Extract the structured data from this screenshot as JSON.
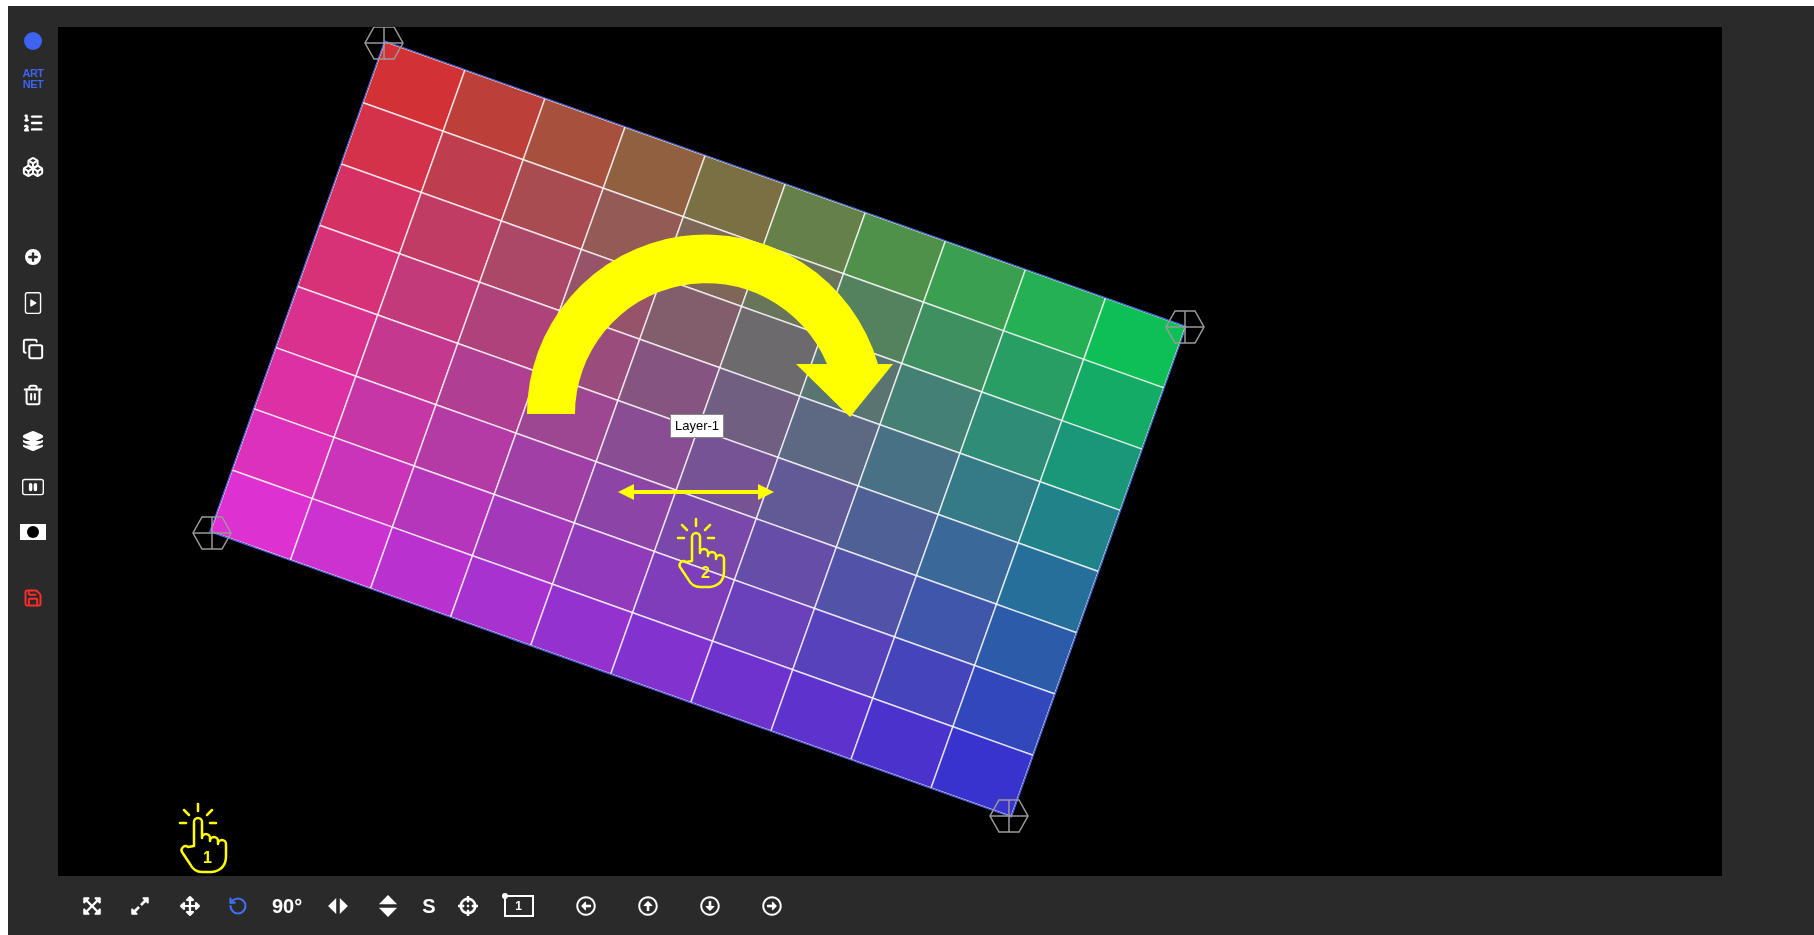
{
  "sidebar": {
    "logo": [
      "ART",
      "NET"
    ]
  },
  "canvas": {
    "layer": {
      "label": "Layer-1"
    },
    "annotations": [
      {
        "kind": "hand",
        "label": "2"
      },
      {
        "kind": "hand",
        "label": "1"
      }
    ]
  },
  "toolbar": [
    {
      "kind": "icon",
      "selected": false
    },
    {
      "kind": "icon",
      "selected": false
    },
    {
      "kind": "icon",
      "selected": false
    },
    {
      "kind": "icon",
      "selected": true
    },
    {
      "kind": "text",
      "label": "90°",
      "selected": false
    },
    {
      "kind": "icon",
      "selected": false
    },
    {
      "kind": "icon",
      "selected": false
    },
    {
      "kind": "text",
      "label": "S",
      "selected": false
    },
    {
      "kind": "icon",
      "selected": false
    },
    {
      "kind": "frame",
      "label": "1",
      "selected": false
    },
    {
      "kind": "icon",
      "selected": false
    },
    {
      "kind": "icon",
      "selected": false
    },
    {
      "kind": "icon",
      "selected": false
    },
    {
      "kind": "icon",
      "selected": false
    }
  ]
}
